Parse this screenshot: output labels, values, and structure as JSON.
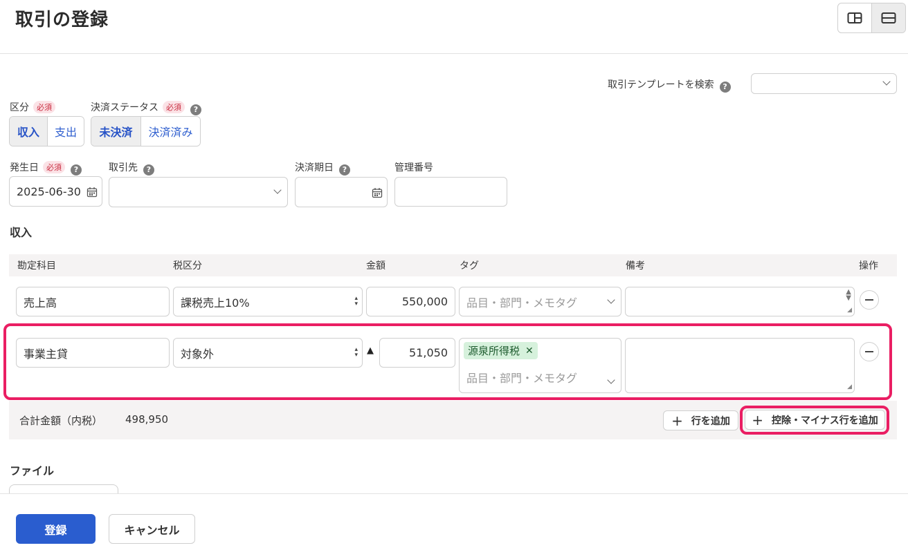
{
  "page": {
    "title": "取引の登録"
  },
  "template_search": {
    "label": "取引テンプレートを検索",
    "value": ""
  },
  "kubun": {
    "label": "区分",
    "required": "必須",
    "options": [
      "収入",
      "支出"
    ],
    "selected": "収入"
  },
  "status": {
    "label": "決済ステータス",
    "required": "必須",
    "options": [
      "未決済",
      "決済済み"
    ],
    "selected": "未決済"
  },
  "date": {
    "label": "発生日",
    "required": "必須",
    "value": "2025-06-30"
  },
  "partner": {
    "label": "取引先",
    "value": ""
  },
  "due_date": {
    "label": "決済期日",
    "value": ""
  },
  "mgmt_no": {
    "label": "管理番号",
    "value": ""
  },
  "section": {
    "title": "収入"
  },
  "table": {
    "headers": {
      "account": "勘定科目",
      "tax": "税区分",
      "amount": "金額",
      "tag": "タグ",
      "memo": "備考",
      "ops": "操作"
    },
    "tag_placeholder": "品目・部門・メモタグ",
    "rows": [
      {
        "account": "売上高",
        "tax": "課税売上10%",
        "amount": "550,000",
        "tags": [],
        "memo": ""
      },
      {
        "account": "事業主貸",
        "tax": "対象外",
        "deduction_mark": "▲",
        "amount": "51,050",
        "tags": [
          "源泉所得税"
        ],
        "memo": ""
      }
    ]
  },
  "total": {
    "label": "合計金額（内税）",
    "value": "498,950"
  },
  "actions": {
    "add_row": "行を追加",
    "add_deduction_row": "控除・マイナス行を追加"
  },
  "files": {
    "title": "ファイル"
  },
  "footer": {
    "submit": "登録",
    "cancel": "キャンセル"
  },
  "colors": {
    "primary": "#2a5dcf",
    "highlight": "#ea1e63",
    "required": "#c8283c",
    "tag": "#d6f1dc"
  }
}
